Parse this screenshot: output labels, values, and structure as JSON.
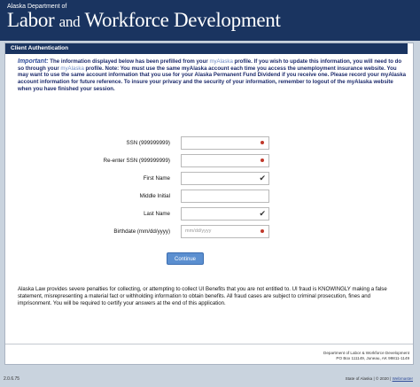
{
  "header": {
    "dept_prefix": "Alaska Department of",
    "title_labor": "Labor",
    "title_and": "and",
    "title_workforce": "Workforce Development"
  },
  "panel": {
    "title": "Client Authentication"
  },
  "notice": {
    "important_label": "Important:",
    "text_a": " The information displayed below has been prefilled from your ",
    "link_a": "myAlaska",
    "text_b": " profile. If you wish to update this information, you will need to do so through your ",
    "link_b": "myAlaska",
    "text_c": " profile. Note: You must use the same myAlaska account each time you access the unemployment insurance website. You may want to use the same account information that you use for your Alaska Permanent Fund Dividend if you receive one. Please record your myAlaska account information for future reference. To insure your privacy and the security of your information, remember to logout of the myAlaska website when you have finished your session."
  },
  "form": {
    "ssn_label": "SSN (999999999)",
    "reenter_ssn_label": "Re-enter SSN (999999999)",
    "first_name_label": "First Name",
    "middle_initial_label": "Middle Initial",
    "last_name_label": "Last Name",
    "birthdate_label": "Birthdate (mm/dd/yyyy)",
    "birthdate_placeholder": "mm/dd/yyyy",
    "continue_label": "Continue"
  },
  "law_text": "Alaska Law provides severe penalties for collecting, or attempting to collect UI Benefits that you are not entitled to. UI fraud is KNOWINGLY making a false statement, misrepresenting a material fact or withholding information to obtain benefits. All fraud cases are subject to criminal prosecution, fines and imprisonment. You will be required to certify your answers at the end of this application.",
  "footer": {
    "addr_line1": "Department of Labor & Workforce Development",
    "addr_line2": "PO Box 111149, Juneau, AK 99811-1149"
  },
  "statusbar": {
    "version": "2.0.6.75",
    "copyright": "State of Alaska | © 2020 | ",
    "webmaster": "Webmaster"
  },
  "colors": {
    "banner": "#1a3460",
    "required": "#c0392b",
    "button": "#5b8fd0"
  }
}
